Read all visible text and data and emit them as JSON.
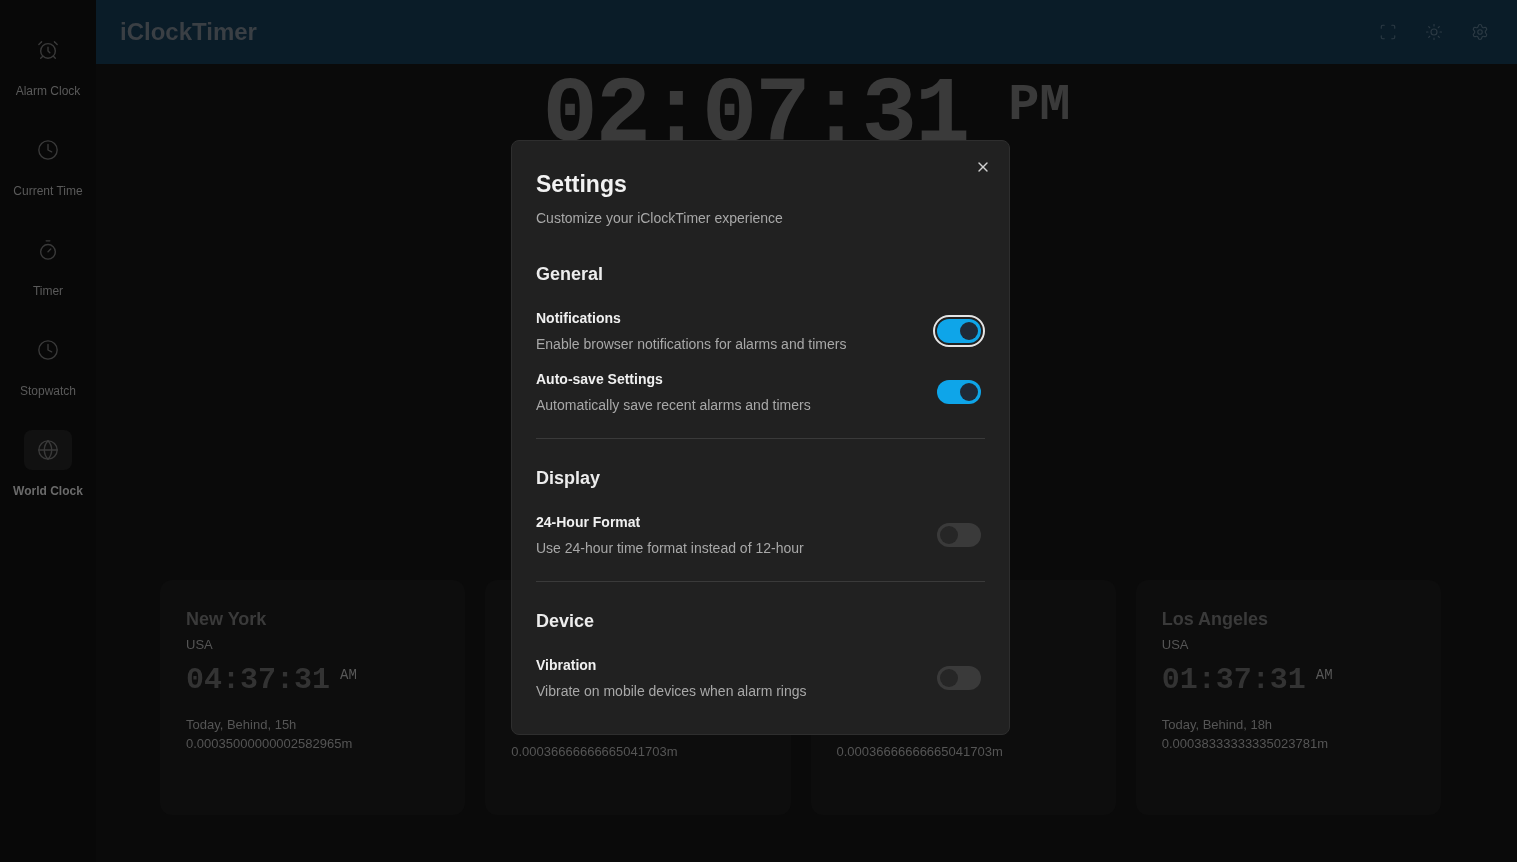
{
  "sidebar": {
    "items": [
      {
        "label": "Alarm Clock",
        "selected": false
      },
      {
        "label": "Current Time",
        "selected": false
      },
      {
        "label": "Timer",
        "selected": false
      },
      {
        "label": "Stopwatch",
        "selected": false
      },
      {
        "label": "World Clock",
        "selected": true
      }
    ]
  },
  "header": {
    "title": "iClockTimer"
  },
  "clock": {
    "time": "02:07:31",
    "period": "PM"
  },
  "world_clocks": [
    {
      "city": "New York",
      "country": "USA",
      "time": "04:37:31",
      "period": "AM",
      "relative": "Today, Behind, 15h",
      "offset": "0.00035000000002582965m"
    },
    {
      "offset": "0.00036666666665041703m"
    },
    {
      "offset": "0.00036666666665041703m"
    },
    {
      "city": "Los Angeles",
      "country": "USA",
      "time": "01:37:31",
      "period": "AM",
      "relative": "Today, Behind, 18h",
      "offset": "0.00038333333335023781m"
    }
  ],
  "dialog": {
    "title": "Settings",
    "subtitle": "Customize your iClockTimer experience",
    "sections": [
      {
        "title": "General",
        "settings": [
          {
            "label": "Notifications",
            "description": "Enable browser notifications for alarms and timers",
            "on": true,
            "focused": true
          },
          {
            "label": "Auto-save Settings",
            "description": "Automatically save recent alarms and timers",
            "on": true,
            "focused": false
          }
        ]
      },
      {
        "title": "Display",
        "settings": [
          {
            "label": "24-Hour Format",
            "description": "Use 24-hour time format instead of 12-hour",
            "on": false,
            "focused": false
          }
        ]
      },
      {
        "title": "Device",
        "settings": [
          {
            "label": "Vibration",
            "description": "Vibrate on mobile devices when alarm rings",
            "on": false,
            "focused": false
          }
        ]
      }
    ]
  }
}
